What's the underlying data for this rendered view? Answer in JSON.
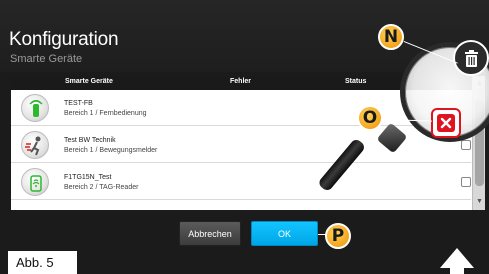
{
  "header": {
    "title": "Konfiguration",
    "subtitle": "Smarte Geräte"
  },
  "table": {
    "columns": [
      "Smarte Geräte",
      "Fehler",
      "Status"
    ],
    "rows": [
      {
        "name": "TEST-FB",
        "area": "Bereich 1 / Fernbedienung",
        "icon": "remote-control-icon",
        "icon_color": "#2eb82e"
      },
      {
        "name": "Test BW Technik",
        "area": "Bereich 1 / Bewegungsmelder",
        "icon": "motion-detector-icon",
        "icon_color": "#d3261d"
      },
      {
        "name": "F1TG15N_Test",
        "area": "Bereich 2 / TAG-Reader",
        "icon": "tag-reader-icon",
        "icon_color": "#2eb82e"
      }
    ]
  },
  "buttons": {
    "cancel": "Abbrechen",
    "ok": "OK"
  },
  "callouts": {
    "n": "N",
    "o": "O",
    "p": "P"
  },
  "figure_label": "Abb. 5",
  "colors": {
    "accent_ok": "#00a6e6",
    "callout": "#f4a51c",
    "delete": "#e0141e"
  }
}
